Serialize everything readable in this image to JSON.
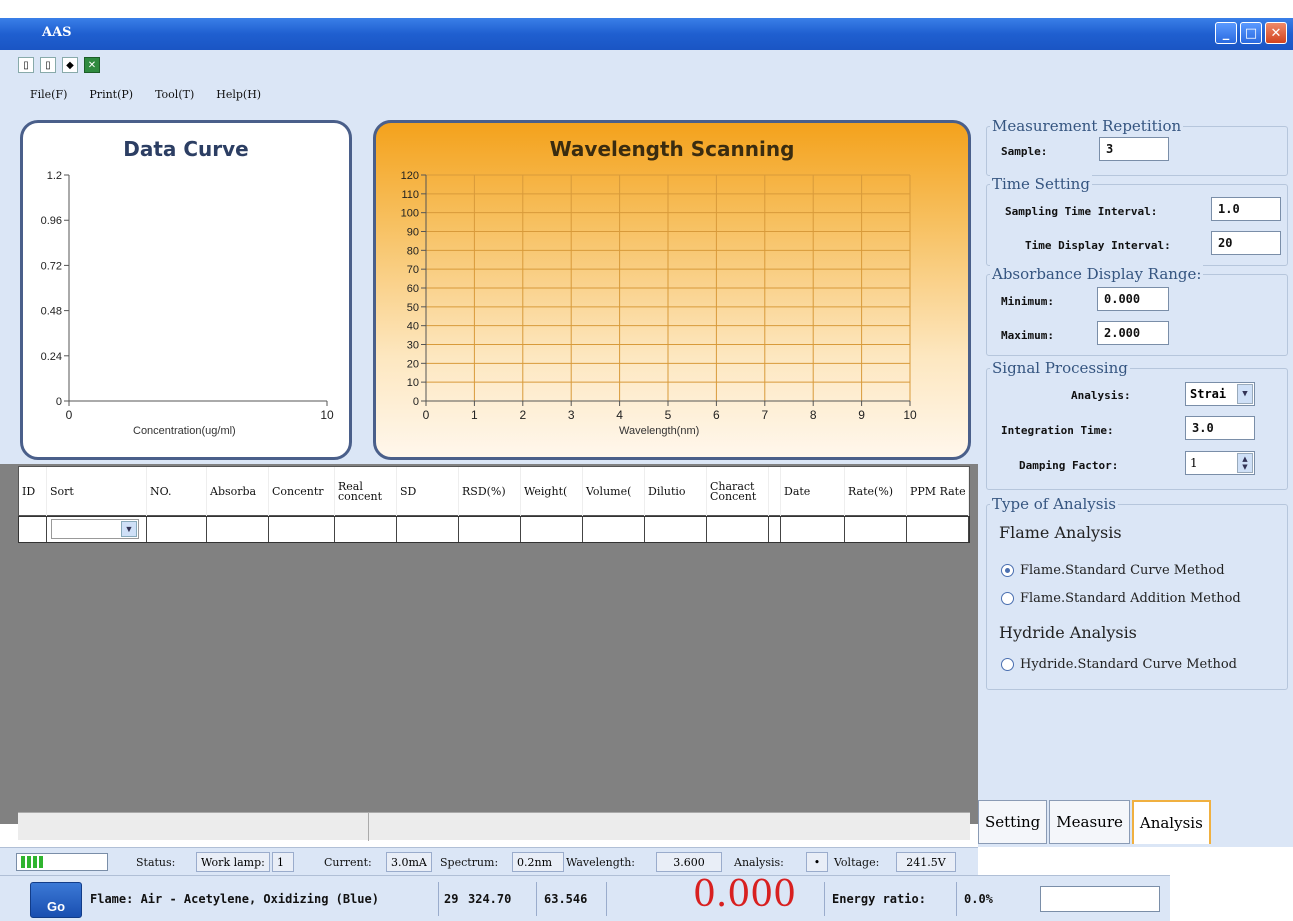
{
  "window": {
    "title": "AAS"
  },
  "menu": [
    "File(F)",
    "Print(P)",
    "Tool(T)",
    "Help(H)"
  ],
  "chart_data": [
    {
      "type": "line",
      "title": "Data Curve",
      "xlabel": "Concentration(ug/ml)",
      "ylabel": "",
      "x_ticks": [
        "0",
        "10"
      ],
      "y_ticks": [
        "0",
        "0.24",
        "0.48",
        "0.72",
        "0.96",
        "1.2"
      ],
      "xlim": [
        0,
        10
      ],
      "ylim": [
        0,
        1.2
      ],
      "series": [],
      "grid": false
    },
    {
      "type": "line",
      "title": "Wavelength Scanning",
      "xlabel": "Wavelength(nm)",
      "ylabel": "",
      "x_ticks": [
        "0",
        "1",
        "2",
        "3",
        "4",
        "5",
        "6",
        "7",
        "8",
        "9",
        "10"
      ],
      "y_ticks": [
        "0",
        "10",
        "20",
        "30",
        "40",
        "50",
        "60",
        "70",
        "80",
        "90",
        "100",
        "110",
        "120"
      ],
      "xlim": [
        0,
        10
      ],
      "ylim": [
        0,
        120
      ],
      "series": [],
      "grid": true
    }
  ],
  "table": {
    "columns": [
      "ID",
      "Sort",
      "NO.",
      "Absorba",
      "Concentr",
      "Real concent",
      "SD",
      "RSD(%)",
      "Weight(",
      "Volume(",
      "Dilutio",
      "Charact Concent",
      "",
      "Date",
      "Rate(%)",
      "PPM Rate"
    ]
  },
  "right": {
    "measurement": {
      "legend": "Measurement Repetition",
      "sample_label": "Sample:",
      "sample_value": "3"
    },
    "time": {
      "legend": "Time Setting",
      "sampling_label": "Sampling Time Interval:",
      "sampling_value": "1.0",
      "display_label": "Time Display Interval:",
      "display_value": "20"
    },
    "absorbance": {
      "legend": "Absorbance Display Range:",
      "min_label": "Minimum:",
      "min_value": "0.000",
      "max_label": "Maximum:",
      "max_value": "2.000"
    },
    "signal": {
      "legend": "Signal Processing",
      "analysis_label": "Analysis:",
      "analysis_value": "Strai",
      "integration_label": "Integration Time:",
      "integration_value": "3.0",
      "damping_label": "Damping Factor:",
      "damping_value": "1"
    },
    "type": {
      "legend": "Type of Analysis",
      "flame_title": "Flame Analysis",
      "flame_std": "Flame.Standard Curve Method",
      "flame_add": "Flame.Standard Addition Method",
      "hydride_title": "Hydride Analysis",
      "hydride_std": "Hydride.Standard Curve Method"
    }
  },
  "tabs": [
    "Setting",
    "Measure",
    "Analysis"
  ],
  "status": {
    "status_label": "Status:",
    "status_value": "Work lamp:",
    "lamp_no": "1",
    "current_label": "Current:",
    "current_value": "3.0mA",
    "spectrum_label": "Spectrum:",
    "spectrum_value": "0.2nm",
    "wavelength_label": "Wavelength:",
    "wavelength_value": "3.600",
    "analysis_label": "Analysis:",
    "analysis_value": "•",
    "voltage_label": "Voltage:",
    "voltage_value": "241.5V"
  },
  "bottom": {
    "go": "Go",
    "flame": "Flame: Air - Acetylene, Oxidizing (Blue)",
    "v1": "29",
    "v2": "324.70",
    "v3": "63.546",
    "reading": "0.000",
    "energy_label": "Energy ratio:",
    "energy_value": "0.0%"
  }
}
